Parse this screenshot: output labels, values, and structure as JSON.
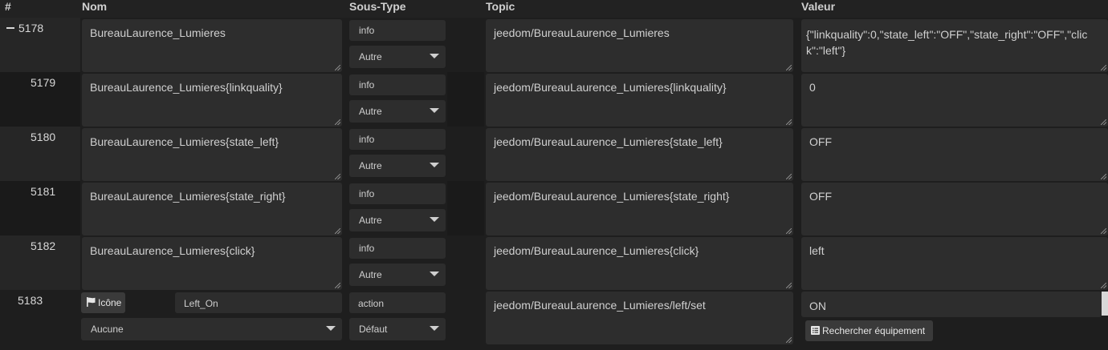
{
  "headers": {
    "id": "#",
    "name": "Nom",
    "subtype": "Sous-Type",
    "topic": "Topic",
    "value": "Valeur"
  },
  "rows": [
    {
      "id": "5178",
      "name": "BureauLaurence_Lumieres",
      "type": "info",
      "subtype": "Autre",
      "topic": "jeedom/BureauLaurence_Lumieres",
      "value": "{\"linkquality\":0,\"state_left\":\"OFF\",\"state_right\":\"OFF\",\"click\":\"left\"}"
    },
    {
      "id": "5179",
      "name": "BureauLaurence_Lumieres{linkquality}",
      "type": "info",
      "subtype": "Autre",
      "topic": "jeedom/BureauLaurence_Lumieres{linkquality}",
      "value": "0"
    },
    {
      "id": "5180",
      "name": "BureauLaurence_Lumieres{state_left}",
      "type": "info",
      "subtype": "Autre",
      "topic": "jeedom/BureauLaurence_Lumieres{state_left}",
      "value": "OFF"
    },
    {
      "id": "5181",
      "name": "BureauLaurence_Lumieres{state_right}",
      "type": "info",
      "subtype": "Autre",
      "topic": "jeedom/BureauLaurence_Lumieres{state_right}",
      "value": "OFF"
    },
    {
      "id": "5182",
      "name": "BureauLaurence_Lumieres{click}",
      "type": "info",
      "subtype": "Autre",
      "topic": "jeedom/BureauLaurence_Lumieres{click}",
      "value": "left"
    }
  ],
  "action_row": {
    "id": "5183",
    "icon_button": "Icône",
    "name": "Left_On",
    "icon_select": "Aucune",
    "type": "action",
    "subtype": "Défaut",
    "topic": "jeedom/BureauLaurence_Lumieres/left/set",
    "value": "ON",
    "search_button": "Rechercher équipement"
  }
}
